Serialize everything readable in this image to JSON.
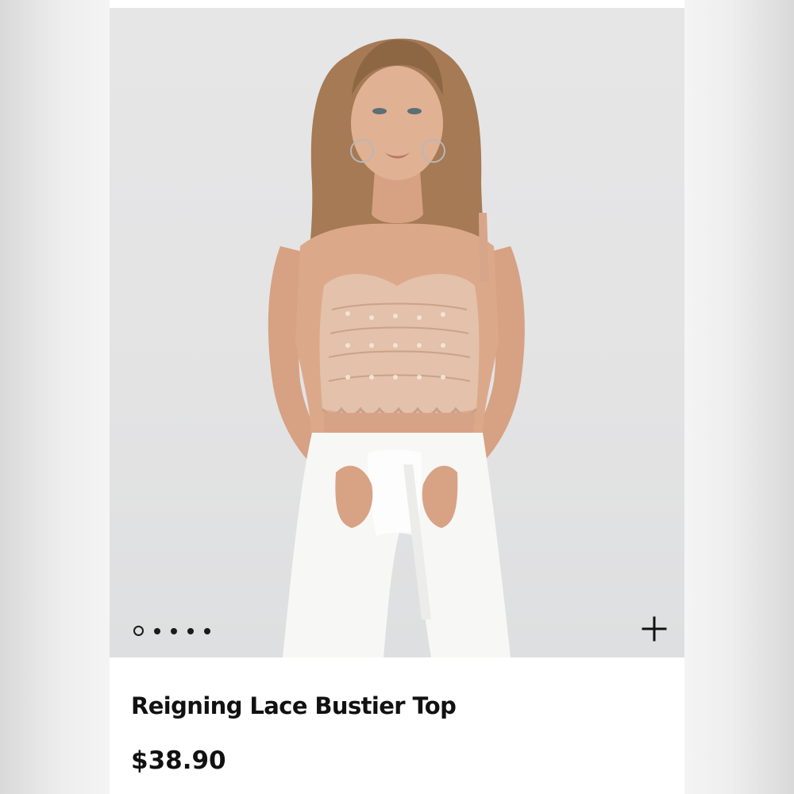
{
  "product": {
    "title": "Reigning Lace Bustier Top",
    "price": "$38.90",
    "image_description": "model wearing lace bustier top and white high-waisted pants"
  },
  "carousel": {
    "total_slides": 5,
    "active_index": 0
  },
  "actions": {
    "add_icon": "plus-icon"
  },
  "colors": {
    "background": "#f4f4f4",
    "card": "#ffffff",
    "image_bg": "#e4e4e5",
    "text": "#111111"
  }
}
